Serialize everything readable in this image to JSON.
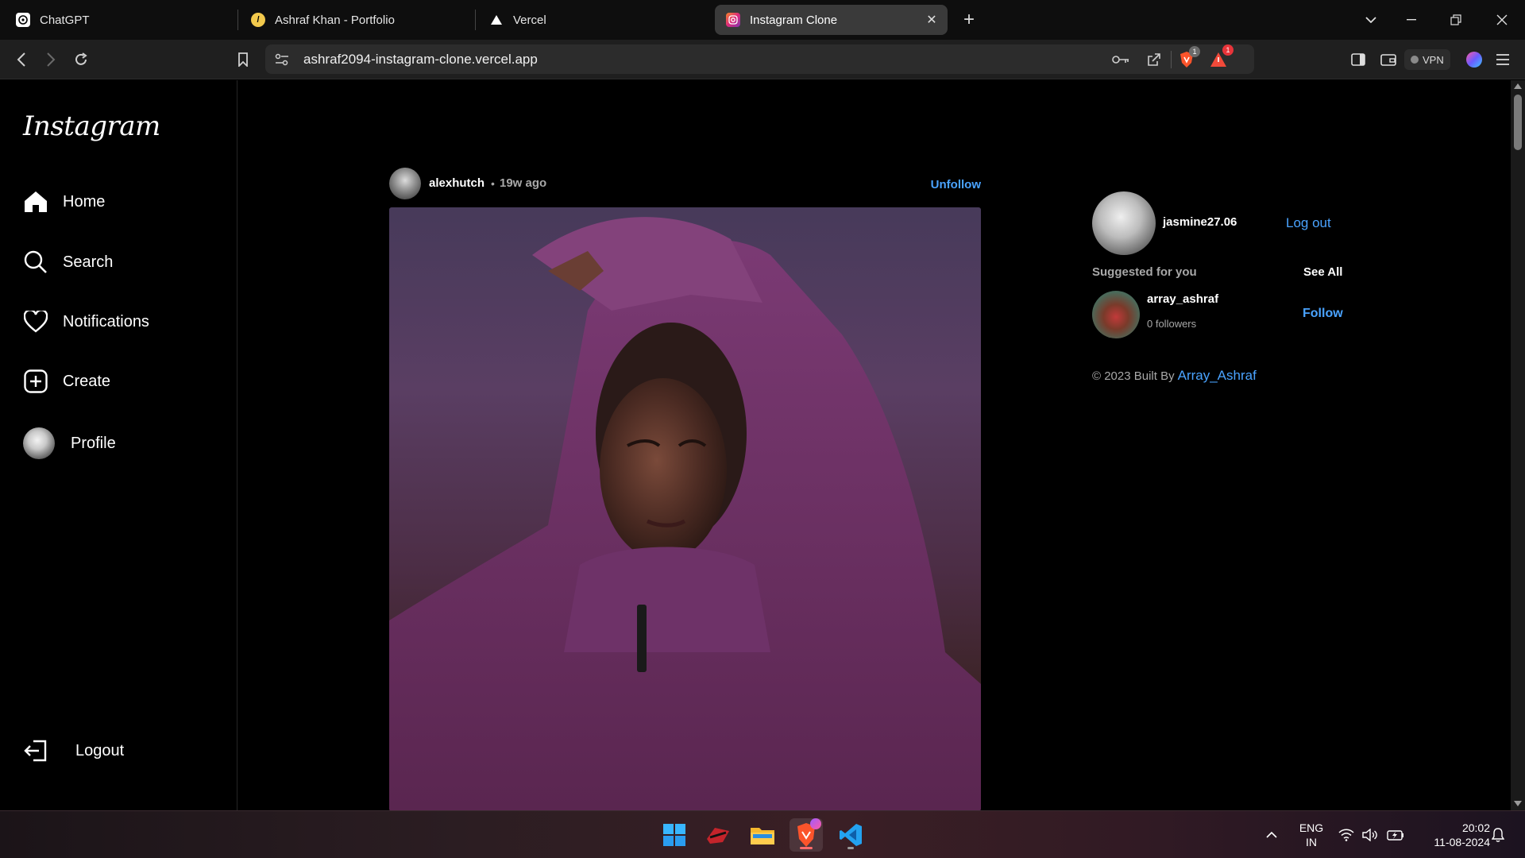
{
  "browser": {
    "tabs": [
      {
        "title": "ChatGPT",
        "active": false
      },
      {
        "title": "Ashraf Khan - Portfolio",
        "active": false
      },
      {
        "title": "Vercel",
        "active": false
      },
      {
        "title": "Instagram Clone",
        "active": true
      }
    ],
    "url": "ashraf2094-instagram-clone.vercel.app",
    "vpn_label": "VPN",
    "shield_badge": "1",
    "rewards_badge": "1"
  },
  "app": {
    "logo": "Instagram",
    "nav": [
      {
        "label": "Home",
        "icon": "home-icon"
      },
      {
        "label": "Search",
        "icon": "search-icon"
      },
      {
        "label": "Notifications",
        "icon": "heart-icon"
      },
      {
        "label": "Create",
        "icon": "plus-square-icon"
      },
      {
        "label": "Profile",
        "icon": "avatar"
      }
    ],
    "logout_label": "Logout"
  },
  "post": {
    "username": "alexhutch",
    "separator": "•",
    "time_ago": "19w ago",
    "action": "Unfollow"
  },
  "current_user": {
    "username": "jasmine27.06",
    "logout": "Log out"
  },
  "suggestions": {
    "heading": "Suggested for you",
    "see_all": "See All",
    "items": [
      {
        "username": "array_ashraf",
        "followers": "0 followers",
        "action": "Follow"
      }
    ]
  },
  "footer": {
    "prefix": "© 2023 Built By",
    "author": "Array_Ashraf"
  },
  "taskbar": {
    "lang_top": "ENG",
    "lang_bottom": "IN",
    "time": "20:02",
    "date": "11-08-2024"
  },
  "colors": {
    "accent_link": "#4aa3ff",
    "muted_text": "#a8a8a8",
    "background": "#000000"
  }
}
